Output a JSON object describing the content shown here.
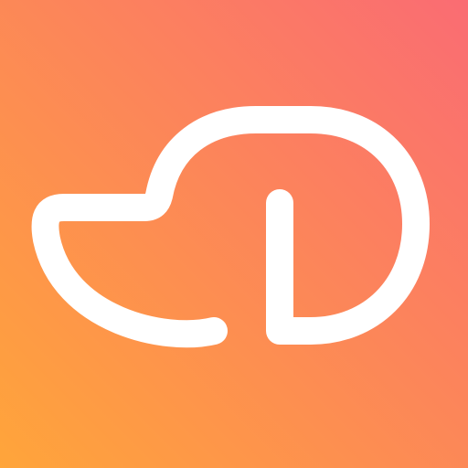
{
  "icon": {
    "name": "cloud-logo-icon",
    "colors": {
      "gradient_start": "#FFA53A",
      "gradient_end": "#FA6C73",
      "stroke": "#FFFFFF"
    }
  }
}
